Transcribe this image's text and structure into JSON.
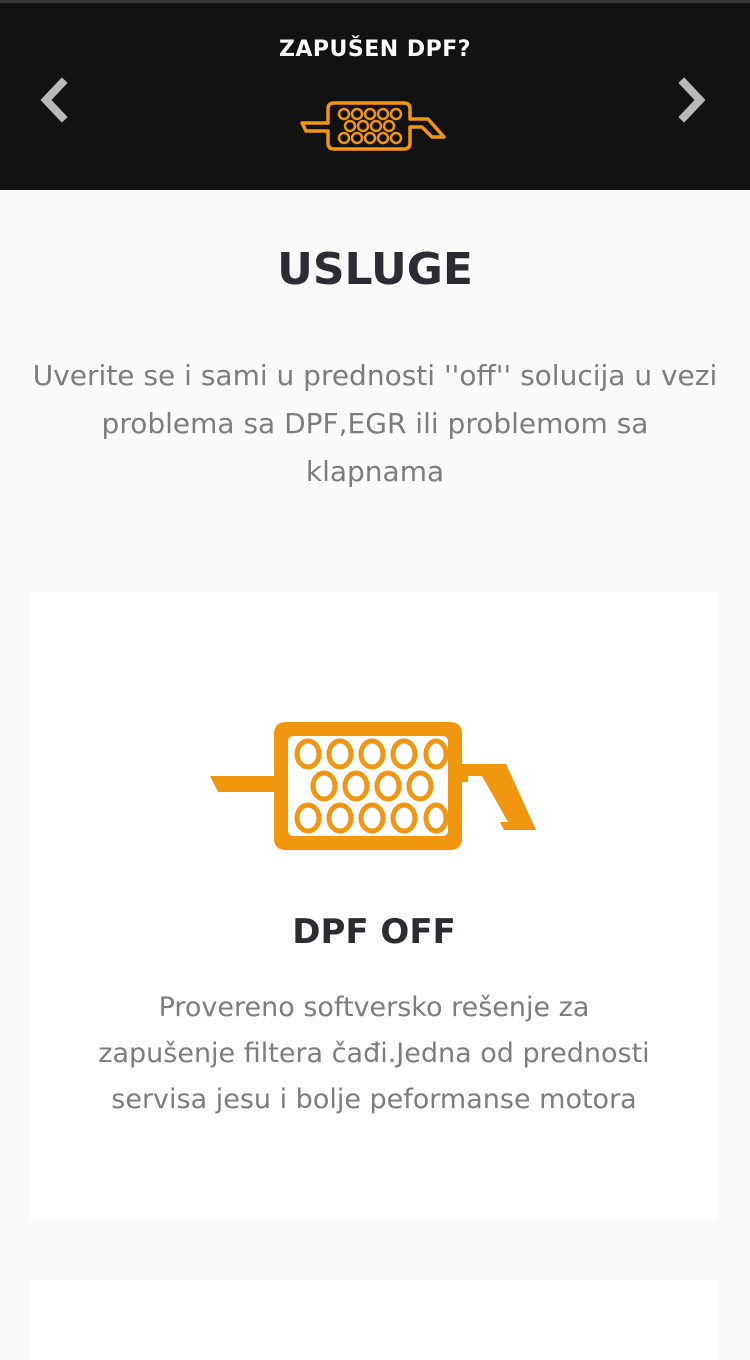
{
  "hero": {
    "title": "ZAPUŠEN DPF?",
    "logo_icon": "dpf-filter-icon",
    "prev_icon": "chevron-left-icon",
    "next_icon": "chevron-right-icon"
  },
  "services": {
    "heading": "USLUGE",
    "intro": "Uverite se i sami u prednosti ''off'' solucija u vezi problema sa DPF,EGR ili problemom sa klapnama",
    "cards": [
      {
        "icon": "dpf-filter-icon",
        "title": "DPF OFF",
        "text": "Provereno softversko rešenje za zapušenje filtera čađi.Jedna od prednosti servisa jesu i bolje peformanse motora"
      }
    ]
  },
  "colors": {
    "accent": "#f0960f",
    "hero_bg": "#121212",
    "page_bg": "#fafafa",
    "heading": "#2c2c33",
    "body_text": "#7d7d7d"
  }
}
